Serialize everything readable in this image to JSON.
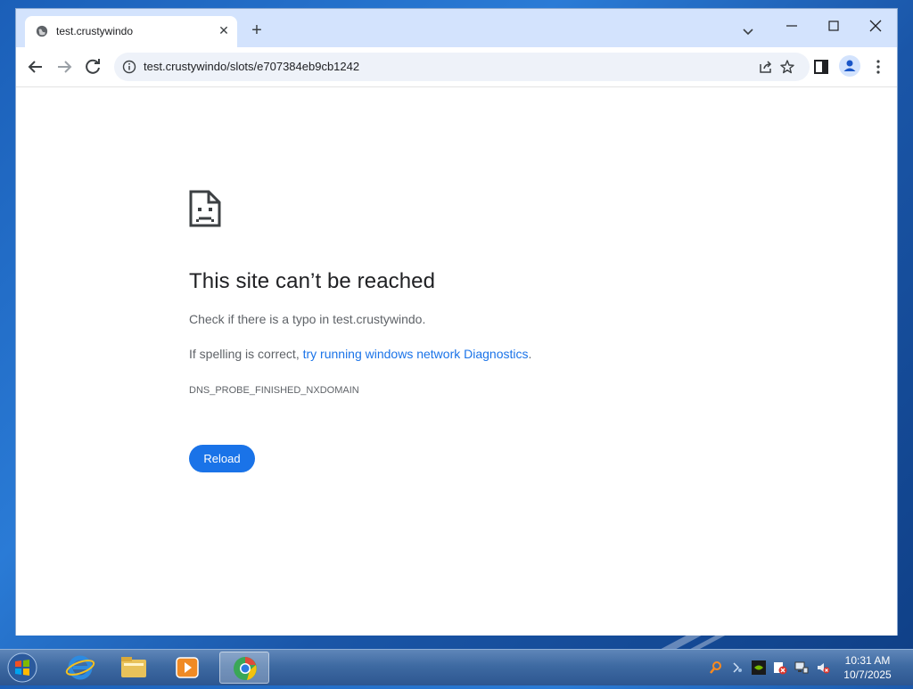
{
  "browser": {
    "tab": {
      "title": "test.crustywindo"
    },
    "omnibox": {
      "url": "test.crustywindo/slots/e707384eb9cb1242"
    }
  },
  "page": {
    "heading": "This site can’t be reached",
    "check_text": "Check if there is a typo in test.crustywindo.",
    "spelling_prefix": "If spelling is correct, ",
    "diagnostics_link": "try running windows network Diagnostics",
    "spelling_suffix": ".",
    "error_code": "DNS_PROBE_FINISHED_NXDOMAIN",
    "reload_label": "Reload"
  },
  "taskbar": {
    "apps": [
      "internet-explorer",
      "file-explorer",
      "media-player",
      "chrome"
    ],
    "clock": {
      "time": "10:31 AM",
      "date": "10/7/2025"
    }
  },
  "colors": {
    "accent": "#1a73e8",
    "tabstrip": "#d3e3fd",
    "text": "#202124",
    "secondary_text": "#5f6368"
  }
}
